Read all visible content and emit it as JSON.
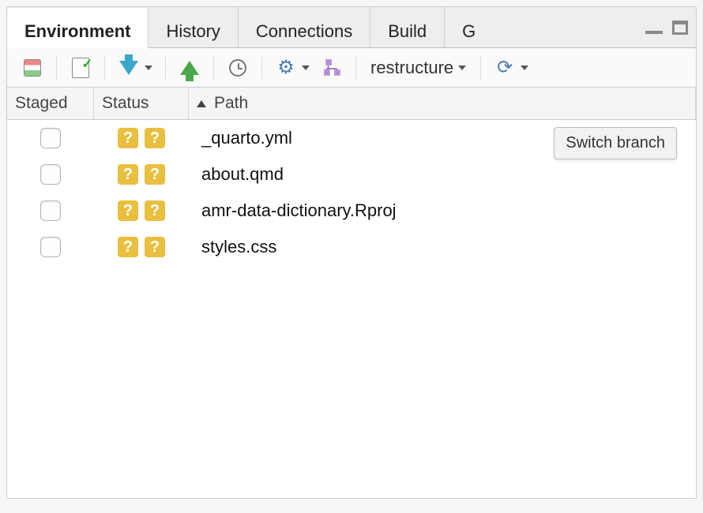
{
  "tabs": {
    "environment": "Environment",
    "history": "History",
    "connections": "Connections",
    "build": "Build",
    "git": "G"
  },
  "toolbar": {
    "branch": "restructure"
  },
  "columns": {
    "staged": "Staged",
    "status": "Status",
    "path": "Path"
  },
  "files": [
    {
      "status1": "?",
      "status2": "?",
      "path": "_quarto.yml"
    },
    {
      "status1": "?",
      "status2": "?",
      "path": "about.qmd"
    },
    {
      "status1": "?",
      "status2": "?",
      "path": "amr-data-dictionary.Rproj"
    },
    {
      "status1": "?",
      "status2": "?",
      "path": "styles.css"
    }
  ],
  "tooltip": "Switch branch"
}
